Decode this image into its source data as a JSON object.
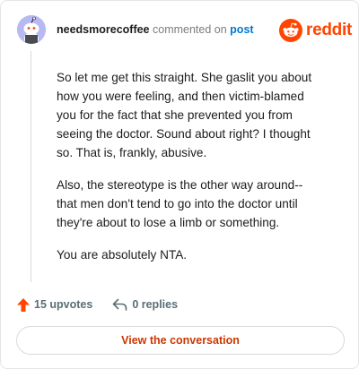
{
  "comment": {
    "username": "needsmorecoffee",
    "commented_on": "commented on",
    "post_link": "post",
    "paragraphs": [
      "So let me get this straight. She gaslit you about how you were feeling, and then victim-blamed you for the fact that she prevented you from seeing the doctor. Sound about right? I thought so. That is, frankly, abusive.",
      "Also, the stereotype is the other way around-- that men don't tend to go into the doctor until they're about to lose a limb or something.",
      "You are absolutely NTA."
    ]
  },
  "brand": {
    "name": "reddit",
    "accent": "#ff4500"
  },
  "footer": {
    "upvotes": "15 upvotes",
    "replies": "0 replies"
  },
  "actions": {
    "view_conversation": "View the conversation"
  },
  "colors": {
    "upvote": "#ff4500",
    "link": "#0079d3",
    "avatar_bg": "#b7b9f2"
  }
}
